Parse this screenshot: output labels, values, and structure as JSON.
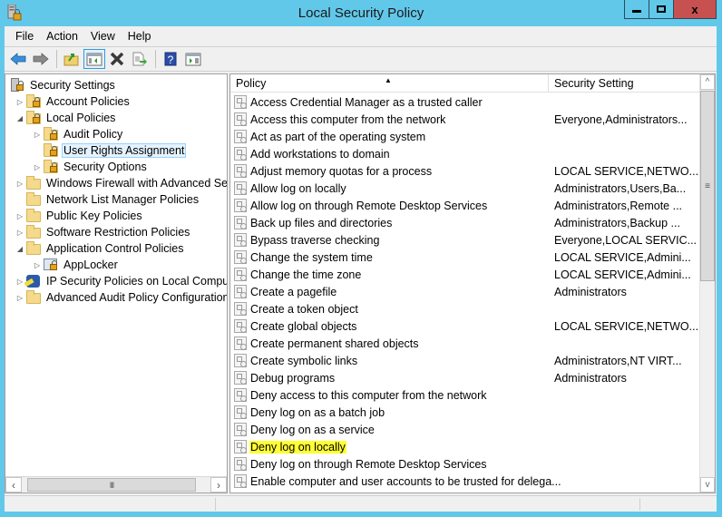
{
  "window": {
    "title": "Local Security Policy",
    "minimize_icon": "minimize-icon",
    "maximize_icon": "maximize-icon",
    "close_icon": "close-icon",
    "close_glyph": "x",
    "accent": "#62c8ea",
    "close_color": "#c75050"
  },
  "menu": {
    "items": [
      {
        "label": "File"
      },
      {
        "label": "Action"
      },
      {
        "label": "View"
      },
      {
        "label": "Help"
      }
    ]
  },
  "toolbar": {
    "buttons": [
      {
        "icon": "back-arrow-icon"
      },
      {
        "icon": "forward-arrow-icon"
      },
      {
        "icon": "up-folder-icon"
      },
      {
        "icon": "show-hide-tree-icon"
      },
      {
        "icon": "delete-icon"
      },
      {
        "icon": "export-list-icon"
      },
      {
        "icon": "help-icon"
      },
      {
        "icon": "show-action-pane-icon"
      }
    ]
  },
  "tree": {
    "items": [
      {
        "label": "Security Settings",
        "level": 0,
        "expander": "",
        "icon": "security-settings-icon"
      },
      {
        "label": "Account Policies",
        "level": 1,
        "expander": "collapsed",
        "icon": "locked-folder-icon"
      },
      {
        "label": "Local Policies",
        "level": 1,
        "expander": "expanded",
        "icon": "locked-folder-icon"
      },
      {
        "label": "Audit Policy",
        "level": 2,
        "expander": "collapsed",
        "icon": "locked-folder-icon"
      },
      {
        "label": "User Rights Assignment",
        "level": 2,
        "expander": "",
        "icon": "locked-folder-icon",
        "selected": true
      },
      {
        "label": "Security Options",
        "level": 2,
        "expander": "collapsed",
        "icon": "locked-folder-icon"
      },
      {
        "label": "Windows Firewall with Advanced Secu",
        "level": 1,
        "expander": "collapsed",
        "icon": "folder-icon"
      },
      {
        "label": "Network List Manager Policies",
        "level": 1,
        "expander": "",
        "icon": "folder-icon"
      },
      {
        "label": "Public Key Policies",
        "level": 1,
        "expander": "collapsed",
        "icon": "folder-icon"
      },
      {
        "label": "Software Restriction Policies",
        "level": 1,
        "expander": "collapsed",
        "icon": "folder-icon"
      },
      {
        "label": "Application Control Policies",
        "level": 1,
        "expander": "expanded",
        "icon": "folder-icon"
      },
      {
        "label": "AppLocker",
        "level": 2,
        "expander": "collapsed",
        "icon": "applocker-icon"
      },
      {
        "label": "IP Security Policies on Local Compute",
        "level": 1,
        "expander": "collapsed",
        "icon": "ip-security-icon"
      },
      {
        "label": "Advanced Audit Policy Configuration",
        "level": 1,
        "expander": "collapsed",
        "icon": "folder-icon"
      }
    ],
    "hscroll_grip": "III"
  },
  "list": {
    "columns": {
      "policy": "Policy",
      "setting": "Security Setting"
    },
    "sort_indicator": "▲",
    "rows": [
      {
        "policy": "Access Credential Manager as a trusted caller",
        "setting": ""
      },
      {
        "policy": "Access this computer from the network",
        "setting": "Everyone,Administrators..."
      },
      {
        "policy": "Act as part of the operating system",
        "setting": ""
      },
      {
        "policy": "Add workstations to domain",
        "setting": ""
      },
      {
        "policy": "Adjust memory quotas for a process",
        "setting": "LOCAL SERVICE,NETWO..."
      },
      {
        "policy": "Allow log on locally",
        "setting": "Administrators,Users,Ba..."
      },
      {
        "policy": "Allow log on through Remote Desktop Services",
        "setting": "Administrators,Remote ..."
      },
      {
        "policy": "Back up files and directories",
        "setting": "Administrators,Backup ..."
      },
      {
        "policy": "Bypass traverse checking",
        "setting": "Everyone,LOCAL SERVIC..."
      },
      {
        "policy": "Change the system time",
        "setting": "LOCAL SERVICE,Admini..."
      },
      {
        "policy": "Change the time zone",
        "setting": "LOCAL SERVICE,Admini..."
      },
      {
        "policy": "Create a pagefile",
        "setting": "Administrators"
      },
      {
        "policy": "Create a token object",
        "setting": ""
      },
      {
        "policy": "Create global objects",
        "setting": "LOCAL SERVICE,NETWO..."
      },
      {
        "policy": "Create permanent shared objects",
        "setting": ""
      },
      {
        "policy": "Create symbolic links",
        "setting": "Administrators,NT VIRT..."
      },
      {
        "policy": "Debug programs",
        "setting": "Administrators"
      },
      {
        "policy": "Deny access to this computer from the network",
        "setting": ""
      },
      {
        "policy": "Deny log on as a batch job",
        "setting": ""
      },
      {
        "policy": "Deny log on as a service",
        "setting": ""
      },
      {
        "policy": "Deny log on locally",
        "setting": "",
        "highlighted": true
      },
      {
        "policy": "Deny log on through Remote Desktop Services",
        "setting": ""
      },
      {
        "policy": "Enable computer and user accounts to be trusted for delega...",
        "setting": ""
      }
    ],
    "highlight_color": "#ffff33",
    "vscroll_up": "^",
    "vscroll_down": "v",
    "vscroll_grip": "≡"
  }
}
